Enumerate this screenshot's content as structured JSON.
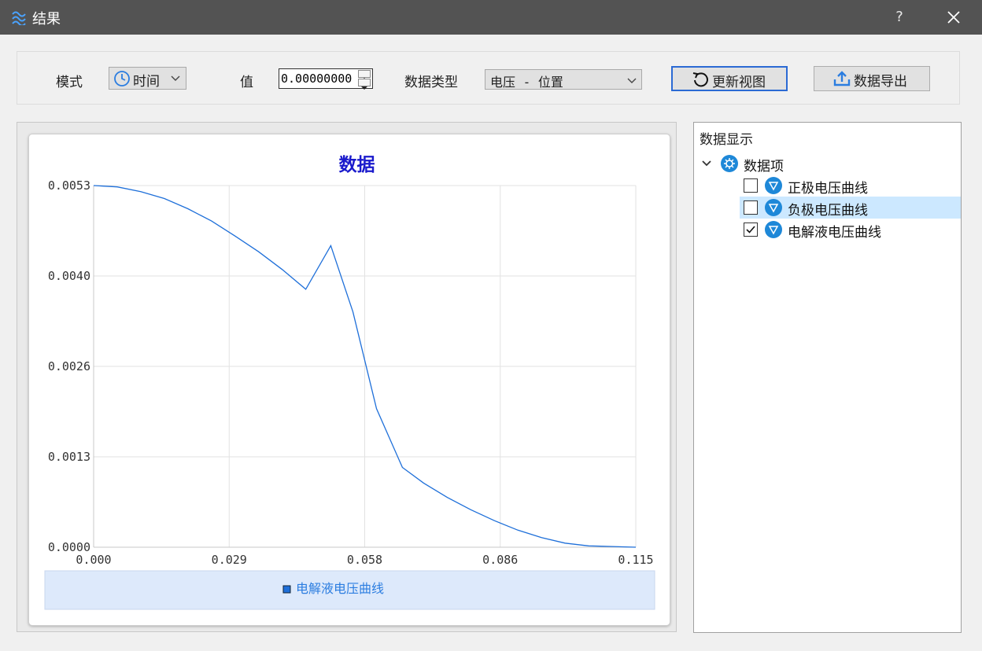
{
  "window": {
    "title": "结果",
    "help_label": "?",
    "icons": {
      "app": "wave-lines-icon",
      "close": "close-icon"
    }
  },
  "toolbar": {
    "mode_label": "模式",
    "mode_value": "时间",
    "value_label": "值",
    "value": "0.00000000",
    "data_type_label": "数据类型",
    "data_type_value": "电压 - 位置",
    "refresh_label": "更新视图",
    "export_label": "数据导出",
    "icons": {
      "mode": "clock-icon",
      "refresh": "refresh-icon",
      "export": "export-upload-icon"
    }
  },
  "chart_data": {
    "type": "line",
    "title": "数据",
    "xlabel": "",
    "ylabel": "",
    "x_ticks": [
      "0.000",
      "0.029",
      "0.058",
      "0.086",
      "0.115"
    ],
    "y_ticks": [
      "0.0053",
      "0.0040",
      "0.0026",
      "0.0013",
      "0.0000"
    ],
    "xlim": [
      0,
      0.115
    ],
    "ylim": [
      0,
      0.0053
    ],
    "grid": true,
    "legend_position": "bottom",
    "series": [
      {
        "name": "电解液电压曲线",
        "color": "#1e6fd9",
        "x": [
          0,
          0.005,
          0.01,
          0.015,
          0.02,
          0.025,
          0.03,
          0.035,
          0.04,
          0.045,
          0.0503,
          0.055,
          0.06,
          0.0655,
          0.07,
          0.075,
          0.08,
          0.085,
          0.09,
          0.095,
          0.1,
          0.105,
          0.11,
          0.115
        ],
        "y": [
          0.0053,
          0.00528,
          0.00521,
          0.00511,
          0.00496,
          0.00478,
          0.00456,
          0.00433,
          0.00407,
          0.00378,
          0.00442,
          0.00345,
          0.00203,
          0.00117,
          0.00094,
          0.00073,
          0.00055,
          0.00039,
          0.00025,
          0.00014,
          6e-05,
          2e-05,
          1e-05,
          0.0
        ]
      }
    ]
  },
  "data_panel": {
    "title": "数据显示",
    "root": {
      "label": "数据项",
      "icon": "gear-node-icon",
      "expand_icon": "chevron-down-icon"
    },
    "items": [
      {
        "label": "正极电压曲线",
        "checked": false,
        "selected": false,
        "icon": "funnel-node-icon"
      },
      {
        "label": "负极电压曲线",
        "checked": false,
        "selected": true,
        "icon": "funnel-node-icon"
      },
      {
        "label": "电解液电压曲线",
        "checked": true,
        "selected": false,
        "icon": "funnel-node-icon"
      }
    ]
  }
}
